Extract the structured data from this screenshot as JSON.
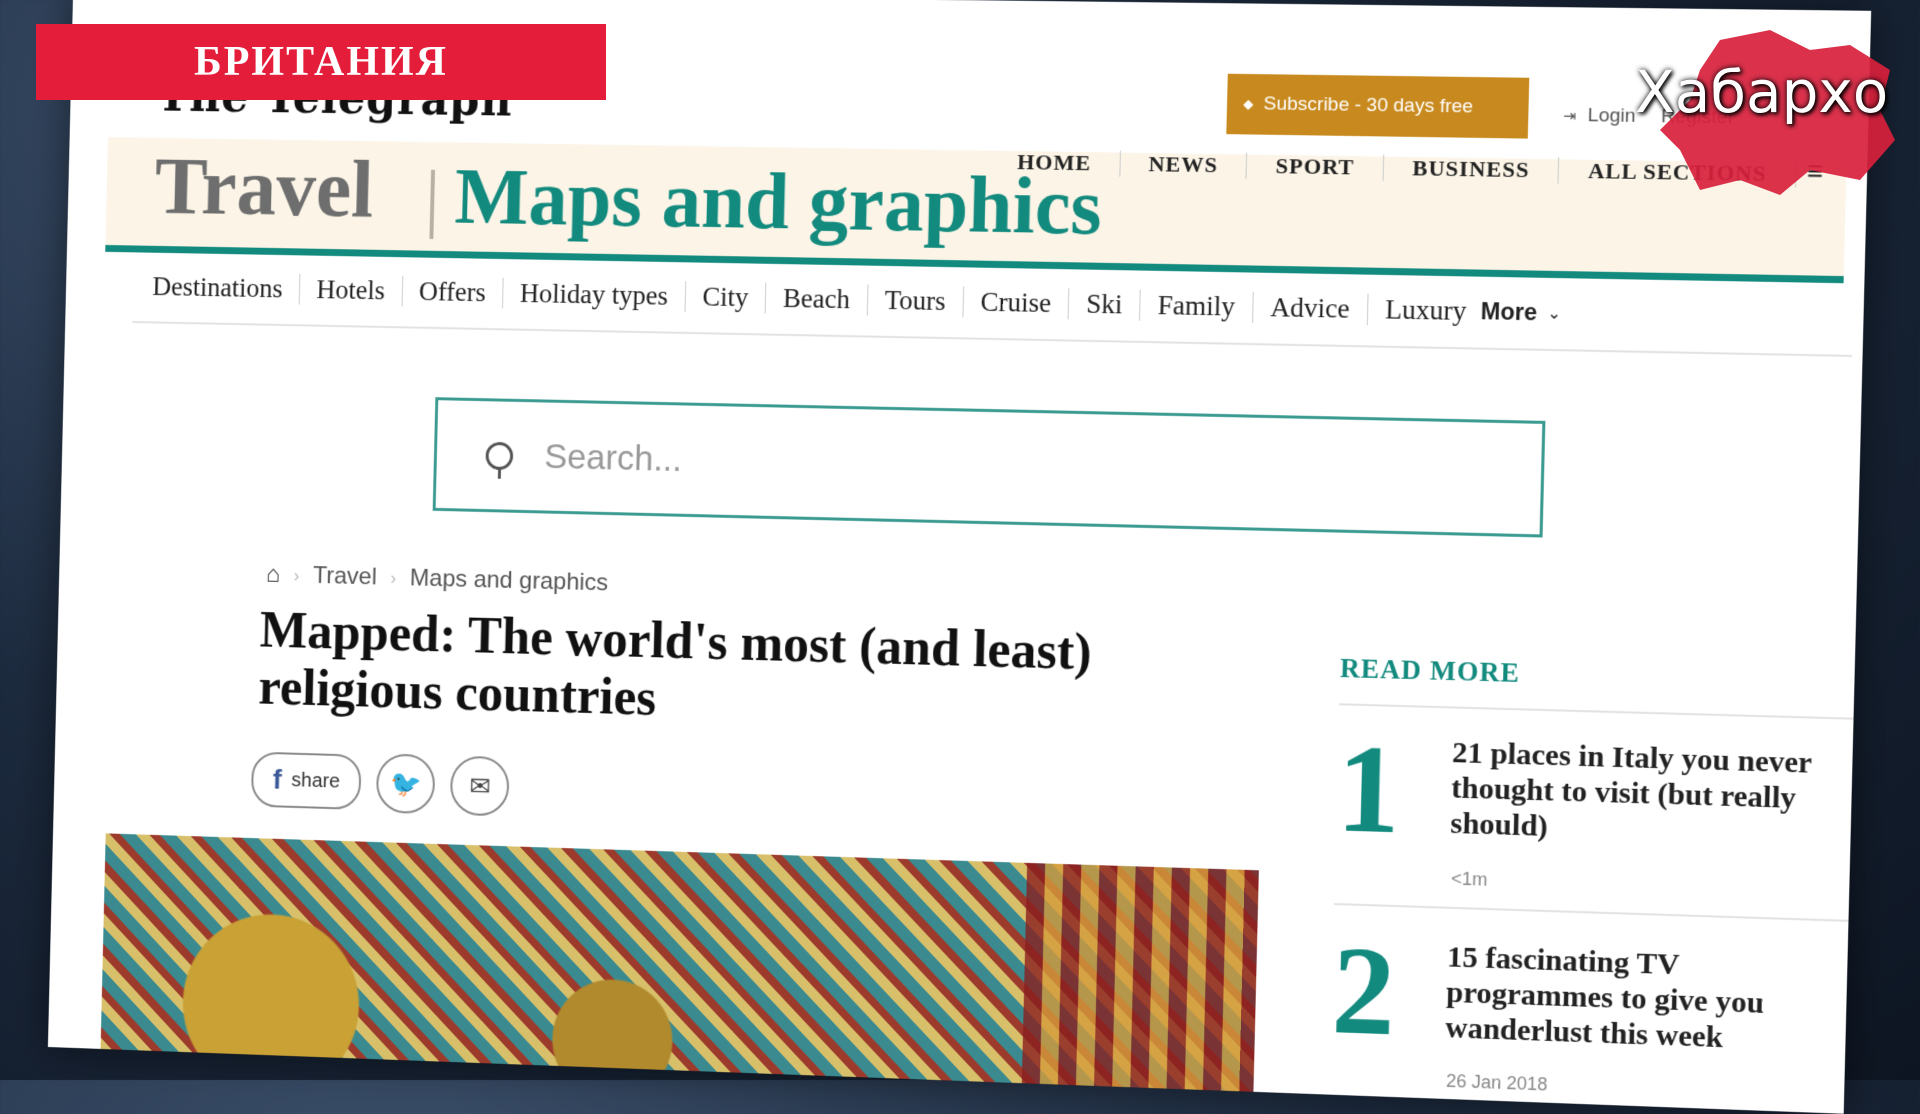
{
  "overlay": {
    "banner_text": "БРИТАНИЯ",
    "logo_text": "Хабархо"
  },
  "header": {
    "brand": "The Telegraph",
    "subscribe_label": "Subscribe - 30 days free",
    "login_label": "Login",
    "register_label": "Register",
    "section_title": "Travel",
    "subsection_title": "Maps and graphics",
    "main_nav": [
      "HOME",
      "NEWS",
      "SPORT",
      "BUSINESS",
      "ALL SECTIONS"
    ]
  },
  "subnav": {
    "items": [
      "Destinations",
      "Hotels",
      "Offers",
      "Holiday types",
      "City",
      "Beach",
      "Tours",
      "Cruise",
      "Ski",
      "Family",
      "Advice",
      "Luxury"
    ],
    "more_label": "More"
  },
  "search": {
    "placeholder": "Search..."
  },
  "breadcrumb": {
    "items": [
      "Travel",
      "Maps and graphics"
    ]
  },
  "article": {
    "headline": "Mapped: The world's most (and least) religious countries",
    "share_label": "share"
  },
  "read_more": {
    "title": "READ MORE",
    "items": [
      {
        "number": "1",
        "text": "21 places in Italy you never thought to visit (but really should)",
        "time": "<1m"
      },
      {
        "number": "2",
        "text": "15 fascinating TV programmes to give you wanderlust this week",
        "time": "26 Jan 2018"
      }
    ]
  },
  "colors": {
    "accent": "#138a7e",
    "subscribe": "#c88a1e",
    "banner": "#e41d3a"
  }
}
